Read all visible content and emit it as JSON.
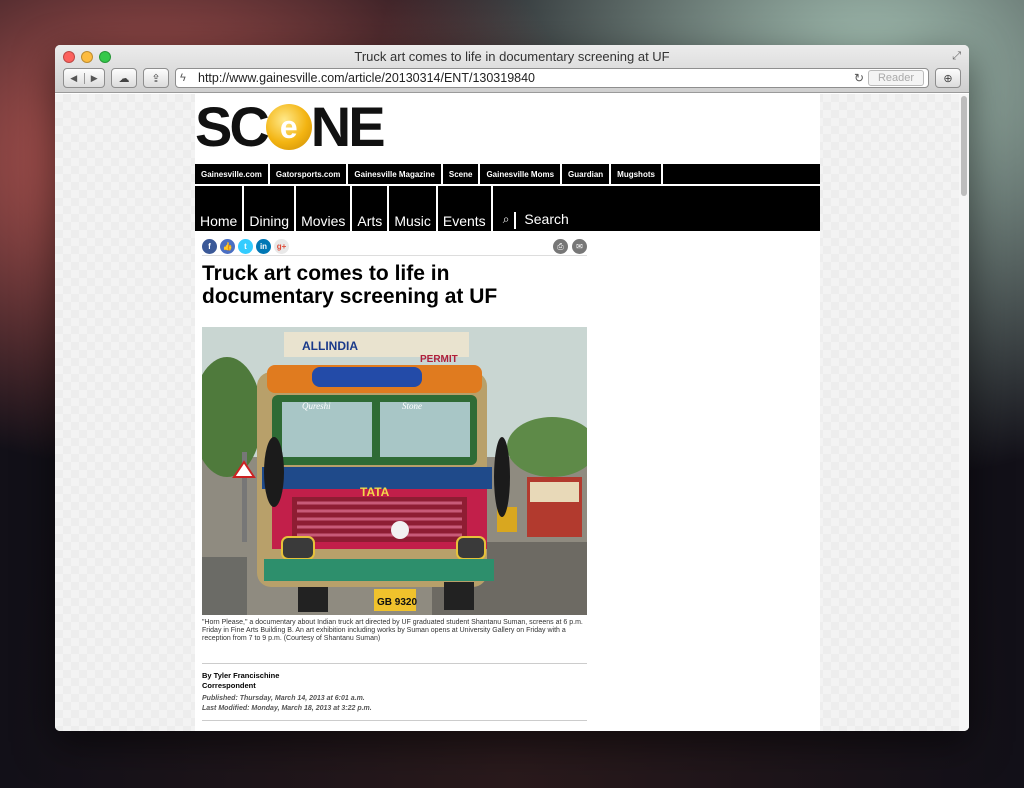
{
  "window": {
    "title": "Truck art comes to life in documentary screening at UF",
    "url": "http://www.gainesville.com/article/20130314/ENT/130319840",
    "reader_label": "Reader"
  },
  "logo": {
    "left": "SC",
    "middle": "e",
    "right": "NE"
  },
  "site_links": [
    "Gainesville.com",
    "Gatorsports.com",
    "Gainesville Magazine",
    "Scene",
    "Gainesville Moms",
    "Guardian",
    "Mugshots"
  ],
  "main_nav": [
    "Home",
    "Dining",
    "Movies",
    "Arts",
    "Music",
    "Events",
    "Search"
  ],
  "article": {
    "headline": "Truck art comes to life in documentary screening at UF",
    "caption": "\"Horn Please,\" a documentary about Indian truck art directed by UF graduated student Shantanu Suman, screens at 6 p.m. Friday in Fine Arts Building B. An art exhibition including works by Suman opens at University Gallery on Friday with a reception from 7 to 9 p.m. (Courtesy of Shantanu Suman)",
    "author": "By Tyler Francischine",
    "author_role": "Correspondent",
    "published": "Published: Thursday, March 14, 2013 at 6:01 a.m.",
    "modified": "Last Modified: Monday, March 18, 2013 at 3:22 p.m."
  },
  "photo_text": {
    "top_sign": "ALLINDIA",
    "permit": "PERMIT",
    "windshield_left": "Qureshi",
    "windshield_right": "Stone",
    "brand": "TATA",
    "plate": "GB 9320"
  },
  "icons": {
    "back": "back-arrow-icon",
    "forward": "forward-arrow-icon",
    "cloud": "cloud-icon",
    "share": "share-icon",
    "reload": "reload-icon",
    "download": "download-icon",
    "search": "search-icon"
  },
  "colors": {
    "nav_bg": "#000000",
    "logo_accent": "#f3b412",
    "facebook": "#3b5998",
    "twitter": "#33ccff",
    "linkedin": "#0077b5"
  }
}
